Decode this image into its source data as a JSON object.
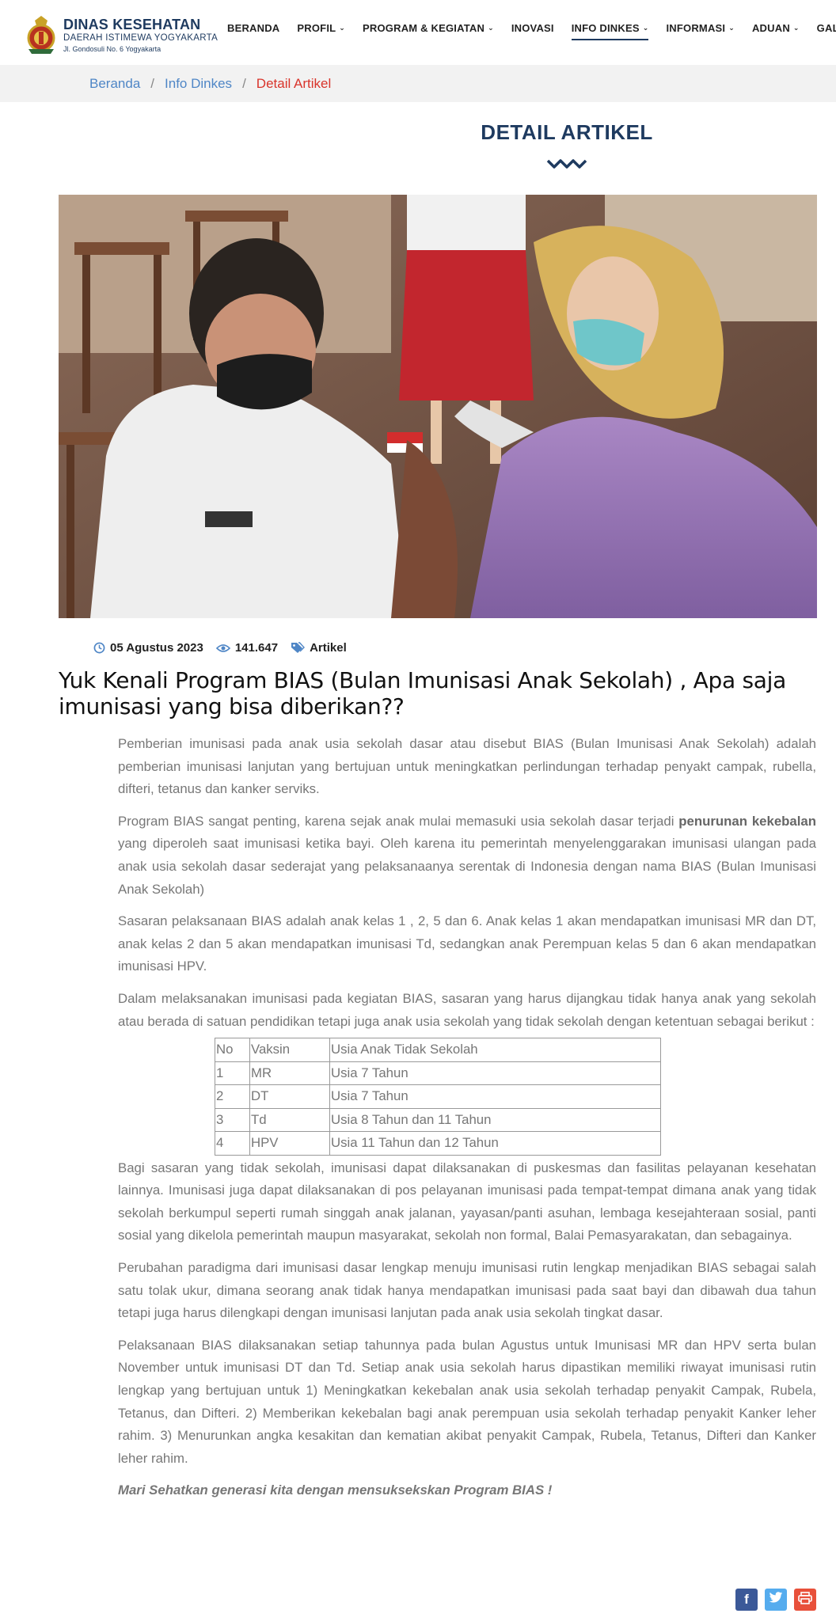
{
  "org": {
    "title": "DINAS KESEHATAN",
    "subtitle": "DAERAH ISTIMEWA YOGYAKARTA",
    "address": "Jl. Gondosuli No. 6 Yogyakarta"
  },
  "nav": {
    "items": [
      {
        "label": "BERANDA",
        "dropdown": false,
        "active": false
      },
      {
        "label": "PROFIL",
        "dropdown": true,
        "active": false
      },
      {
        "label": "PROGRAM & KEGIATAN",
        "dropdown": true,
        "active": false
      },
      {
        "label": "INOVASI",
        "dropdown": false,
        "active": false
      },
      {
        "label": "INFO DINKES",
        "dropdown": true,
        "active": true
      },
      {
        "label": "INFORMASI",
        "dropdown": true,
        "active": false
      },
      {
        "label": "ADUAN",
        "dropdown": true,
        "active": false
      },
      {
        "label": "GALERI",
        "dropdown": false,
        "active": false
      }
    ]
  },
  "breadcrumb": {
    "home": "Beranda",
    "section": "Info Dinkes",
    "current": "Detail Artikel"
  },
  "page": {
    "section_title": "DETAIL ARTIKEL"
  },
  "article": {
    "date": "05 Agustus 2023",
    "views": "141.647",
    "category": "Artikel",
    "title": "Yuk Kenali Program BIAS (Bulan Imunisasi Anak Sekolah) , Apa saja imunisasi yang bisa diberikan??",
    "p1": "Pemberian imunisasi pada anak usia sekolah dasar atau disebut BIAS (Bulan Imunisasi Anak Sekolah) adalah pemberian imunisasi lanjutan yang bertujuan untuk meningkatkan perlindungan terhadap penyakt campak, rubella, difteri, tetanus dan kanker serviks.",
    "p2_before": "Program BIAS sangat penting, karena sejak anak mulai memasuki usia sekolah dasar terjadi ",
    "p2_bold": "penurunan kekebalan",
    "p2_after": " yang diperoleh saat imunisasi ketika bayi. Oleh karena itu pemerintah menyelenggarakan imunisasi ulangan pada anak usia sekolah dasar sederajat yang pelaksanaanya serentak di Indonesia dengan nama BIAS (Bulan Imunisasi Anak Sekolah)",
    "p3": "Sasaran pelaksanaan BIAS adalah anak kelas 1 , 2, 5 dan 6. Anak kelas 1 akan mendapatkan imunisasi MR dan DT, anak kelas 2 dan 5 akan mendapatkan imunisasi Td, sedangkan anak Perempuan kelas 5 dan 6 akan mendapatkan imunisasi HPV.",
    "p4": "Dalam melaksanakan imunisasi pada kegiatan BIAS, sasaran yang harus dijangkau tidak hanya anak yang sekolah atau berada di satuan pendidikan tetapi juga anak usia sekolah yang tidak sekolah dengan ketentuan sebagai berikut :",
    "table": {
      "headers": [
        "No",
        "Vaksin",
        "Usia Anak Tidak Sekolah"
      ],
      "rows": [
        [
          "1",
          "MR",
          "Usia 7 Tahun"
        ],
        [
          "2",
          "DT",
          "Usia 7 Tahun"
        ],
        [
          "3",
          "Td",
          "Usia 8 Tahun dan 11 Tahun"
        ],
        [
          "4",
          "HPV",
          "Usia 11 Tahun dan 12 Tahun"
        ]
      ]
    },
    "p5": "Bagi sasaran yang tidak sekolah, imunisasi dapat dilaksanakan di  puskesmas dan fasilitas pelayanan kesehatan lainnya. Imunisasi juga dapat dilaksanakan di pos pelayanan imunisasi pada tempat-tempat dimana anak yang tidak sekolah berkumpul seperti rumah singgah anak jalanan, yayasan/panti asuhan, lembaga kesejahteraan sosial, panti sosial yang dikelola pemerintah maupun masyarakat, sekolah non formal, Balai Pemasyarakatan, dan sebagainya.",
    "p6": "Perubahan paradigma dari imunisasi dasar lengkap menuju imunisasi rutin lengkap menjadikan BIAS sebagai salah satu tolak ukur, dimana seorang anak tidak hanya mendapatkan imunisasi pada saat bayi dan dibawah dua tahun tetapi juga harus dilengkapi dengan imunisasi lanjutan pada anak usia sekolah tingkat dasar.",
    "p7": "Pelaksanaan BIAS dilaksanakan setiap tahunnya pada bulan Agustus untuk Imunisasi MR dan HPV serta bulan November untuk imunisasi DT dan Td. Setiap anak usia sekolah harus dipastikan memiliki riwayat imunisasi rutin lengkap yang bertujuan untuk 1) Meningkatkan kekebalan anak usia sekolah terhadap penyakit Campak, Rubela, Tetanus, dan Difteri. 2) Memberikan kekebalan bagi anak perempuan usia sekolah terhadap penyakit Kanker leher rahim. 3) Menurunkan angka kesakitan dan kematian akibat penyakit Campak, Rubela, Tetanus, Difteri dan Kanker leher rahim.",
    "closing": "Mari Sehatkan generasi  kita dengan mensuksekskan Program BIAS !"
  },
  "share": {
    "facebook_icon": "facebook-icon",
    "twitter_icon": "twitter-icon",
    "print_icon": "print-icon"
  },
  "colors": {
    "brand": "#1e3a5f",
    "link": "#4f86c6",
    "breadcrumb_current": "#d9342b",
    "body_text": "#777777",
    "facebook": "#3b5998",
    "twitter": "#55acee",
    "print": "#e8503a"
  }
}
